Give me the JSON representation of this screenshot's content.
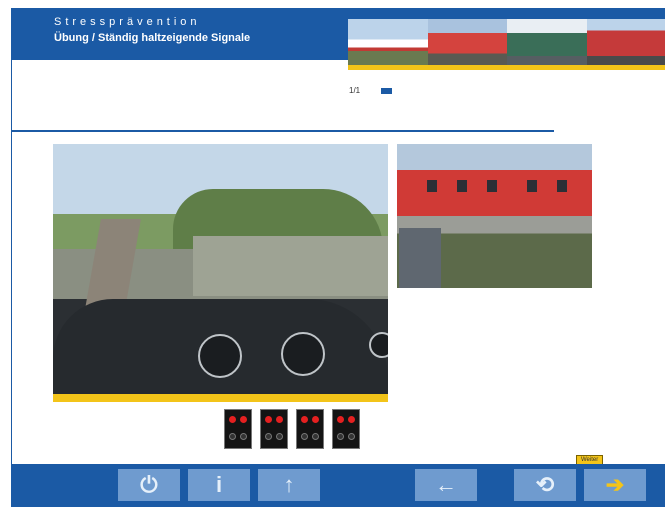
{
  "header": {
    "title": "Stressprävention",
    "subtitle": "Übung / Ständig haltzeigende Signale"
  },
  "page_indicator": "1/1",
  "signals": {
    "count": 4
  },
  "nav": {
    "power": "⏻",
    "info": "i",
    "up": "↑",
    "back": "←",
    "reload": "⟲",
    "next": "➔",
    "next_tooltip": "Weiter"
  },
  "colors": {
    "primary": "#1b5aa5",
    "accent": "#f3c419",
    "button": "#6f9bcf"
  }
}
